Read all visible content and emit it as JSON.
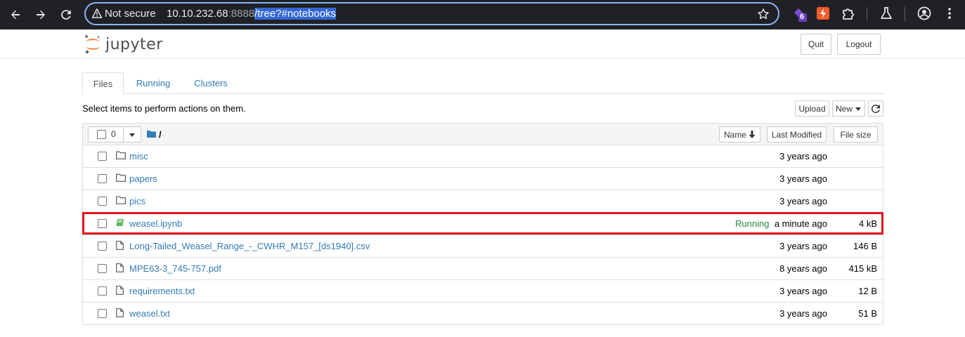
{
  "browser": {
    "security_label": "Not secure",
    "url_host": "10.10.232.68",
    "url_port": ":8888",
    "url_path": "/tree?#notebooks",
    "extension_badge": "6"
  },
  "header": {
    "logo_text": "jupyter",
    "quit_label": "Quit",
    "logout_label": "Logout"
  },
  "tabs": [
    {
      "label": "Files",
      "active": true
    },
    {
      "label": "Running",
      "active": false
    },
    {
      "label": "Clusters",
      "active": false
    }
  ],
  "toolbar": {
    "hint": "Select items to perform actions on them.",
    "upload_label": "Upload",
    "new_label": "New"
  },
  "list_header": {
    "selected_count": "0",
    "path": "/",
    "sort_name_label": "Name",
    "last_modified_label": "Last Modified",
    "file_size_label": "File size"
  },
  "files": [
    {
      "name": "misc",
      "type": "folder",
      "status": "",
      "modified": "3 years ago",
      "size": ""
    },
    {
      "name": "papers",
      "type": "folder",
      "status": "",
      "modified": "3 years ago",
      "size": ""
    },
    {
      "name": "pics",
      "type": "folder",
      "status": "",
      "modified": "3 years ago",
      "size": ""
    },
    {
      "name": "weasel.ipynb",
      "type": "notebook",
      "status": "Running",
      "modified": "a minute ago",
      "size": "4 kB"
    },
    {
      "name": "Long-Tailed_Weasel_Range_-_CWHR_M157_[ds1940].csv",
      "type": "file",
      "status": "",
      "modified": "3 years ago",
      "size": "146 B"
    },
    {
      "name": "MPE63-3_745-757.pdf",
      "type": "file",
      "status": "",
      "modified": "8 years ago",
      "size": "415 kB"
    },
    {
      "name": "requirements.txt",
      "type": "file",
      "status": "",
      "modified": "3 years ago",
      "size": "12 B"
    },
    {
      "name": "weasel.txt",
      "type": "file",
      "status": "",
      "modified": "3 years ago",
      "size": "51 B"
    }
  ],
  "colors": {
    "link": "#337ab7",
    "running": "#2b8a3e",
    "highlight": "#e0151b",
    "browser_bg": "#202124"
  }
}
